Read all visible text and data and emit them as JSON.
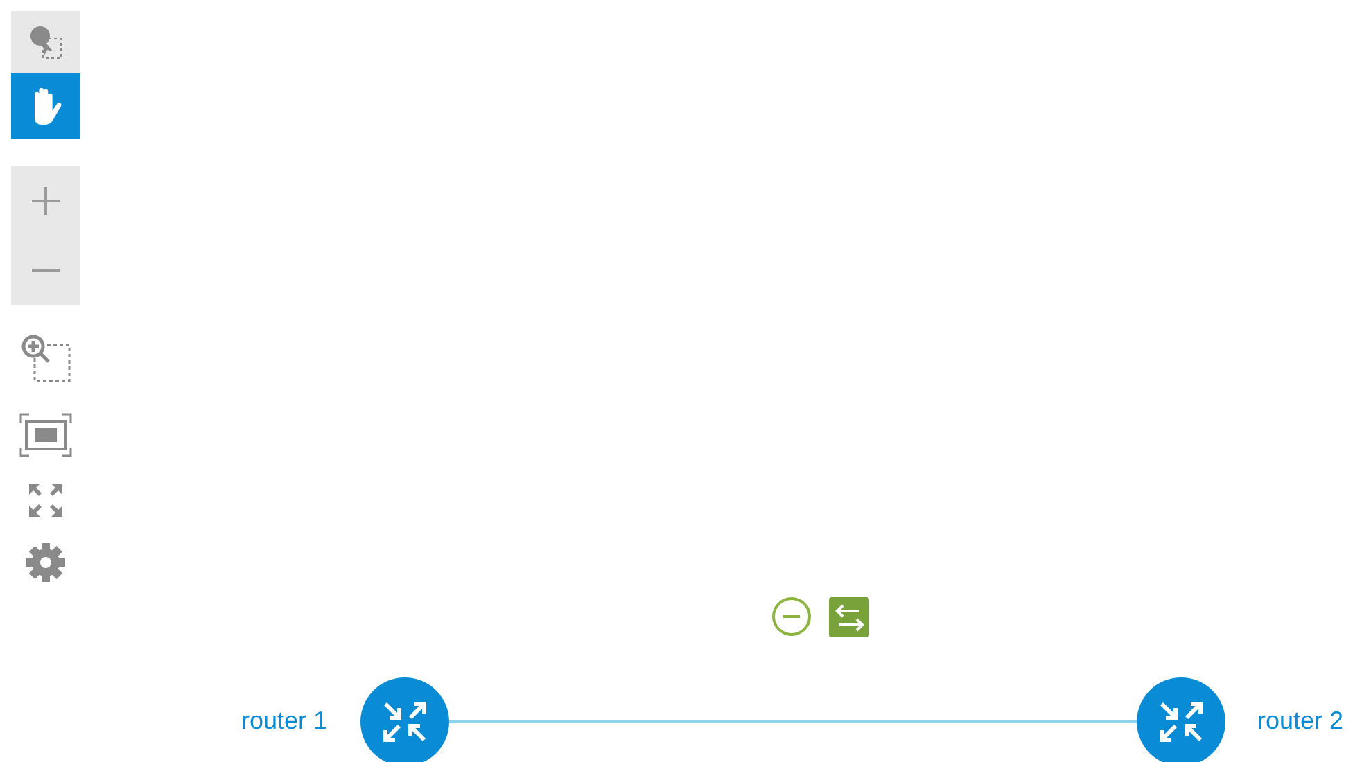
{
  "toolbar": {
    "modes": [
      {
        "kind": "select",
        "selected": false
      },
      {
        "kind": "pan",
        "selected": true
      }
    ]
  },
  "nodes": [
    {
      "label": "router 1"
    },
    {
      "label": "router 2"
    }
  ]
}
